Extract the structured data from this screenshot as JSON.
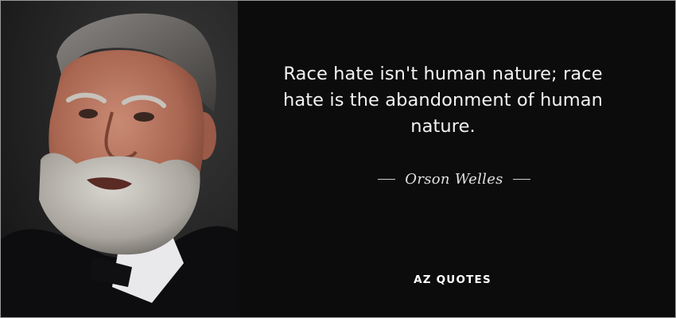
{
  "quote": {
    "text": "Race hate isn't human nature; race hate is the abandonment of human nature.",
    "author": "Orson Welles"
  },
  "brand": {
    "logo": "AZ QUOTES"
  },
  "colors": {
    "background": "#0c0c0c",
    "quote_text": "#f2f2f2",
    "author_text": "#e0e0e0"
  },
  "photo": {
    "icon": "portrait-photo"
  }
}
